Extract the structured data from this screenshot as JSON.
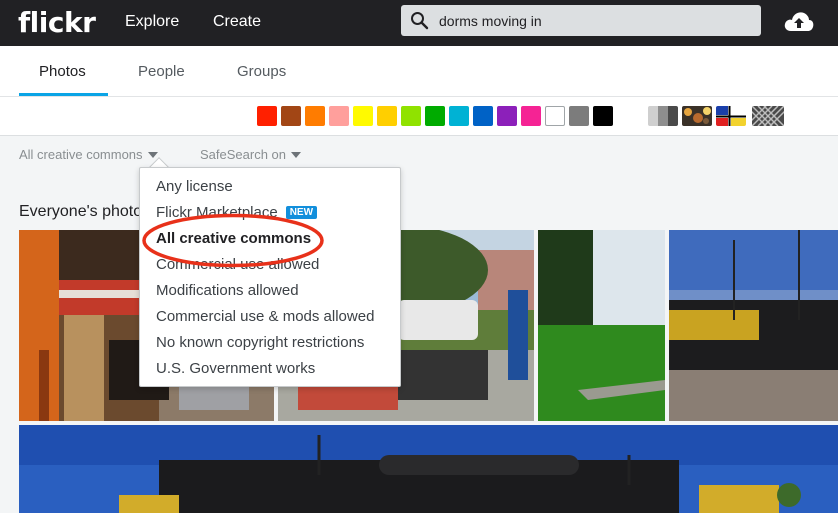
{
  "topnav": {
    "logo": "flickr",
    "explore": "Explore",
    "create": "Create",
    "search_value": "dorms moving in"
  },
  "tabs": [
    "Photos",
    "People",
    "Groups"
  ],
  "color_swatches": [
    "#ff2000",
    "#a24615",
    "#ff7c00",
    "#ff9f9c",
    "#fffa00",
    "#ffcf00",
    "#90e200",
    "#00ab00",
    "#00b2d4",
    "#0062c6",
    "#8c20ba",
    "#f52394",
    "#ffffff",
    "#7c7c7c",
    "#000000"
  ],
  "filters": {
    "license": "All creative commons",
    "safesearch": "SafeSearch on"
  },
  "section_title": "Everyone's photos",
  "license_menu": {
    "items": [
      "Any license",
      "Flickr Marketplace",
      "All creative commons",
      "Commercial use allowed",
      "Modifications allowed",
      "Commercial use & mods allowed",
      "No known copyright restrictions",
      "U.S. Government works"
    ],
    "new_badge": "NEW",
    "selected": "All creative commons"
  },
  "colors": {
    "nav_bg": "#212124",
    "accent": "#0aa4e6",
    "annotation": "#e8311a"
  }
}
